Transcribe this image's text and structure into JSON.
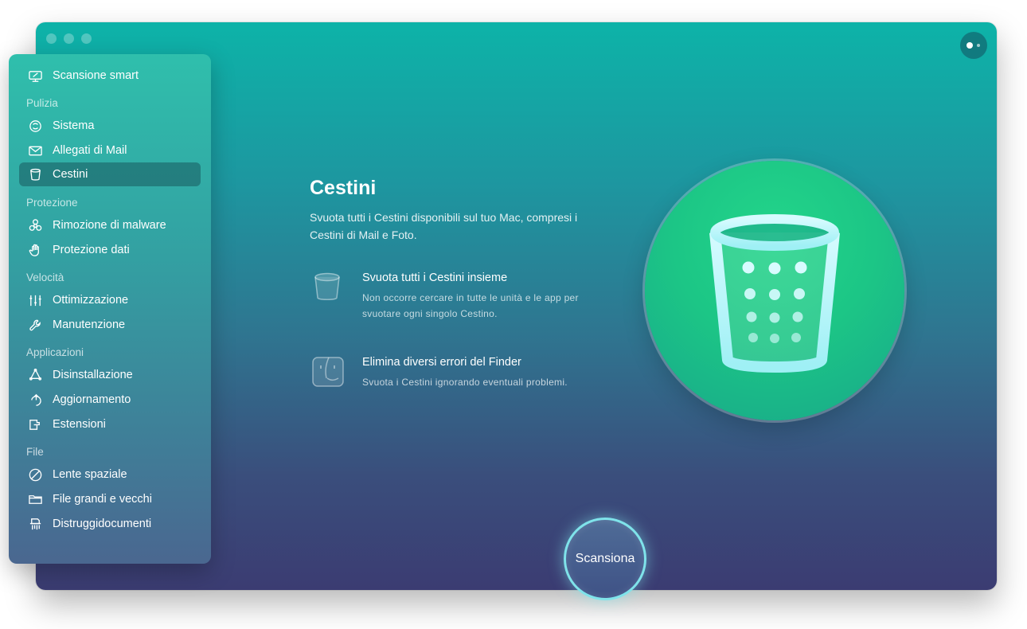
{
  "sidebar": {
    "top_item": {
      "label": "Scansione smart",
      "icon": "monitor-icon"
    },
    "sections": [
      {
        "title": "Pulizia",
        "items": [
          {
            "label": "Sistema",
            "icon": "system-icon"
          },
          {
            "label": "Allegati di Mail",
            "icon": "mail-icon"
          },
          {
            "label": "Cestini",
            "icon": "trash-icon",
            "active": true
          }
        ]
      },
      {
        "title": "Protezione",
        "items": [
          {
            "label": "Rimozione di malware",
            "icon": "biohazard-icon"
          },
          {
            "label": "Protezione dati",
            "icon": "hand-icon"
          }
        ]
      },
      {
        "title": "Velocità",
        "items": [
          {
            "label": "Ottimizzazione",
            "icon": "sliders-icon"
          },
          {
            "label": "Manutenzione",
            "icon": "wrench-icon"
          }
        ]
      },
      {
        "title": "Applicazioni",
        "items": [
          {
            "label": "Disinstallazione",
            "icon": "uninstall-icon"
          },
          {
            "label": "Aggiornamento",
            "icon": "update-icon"
          },
          {
            "label": "Estensioni",
            "icon": "extensions-icon"
          }
        ]
      },
      {
        "title": "File",
        "items": [
          {
            "label": "Lente spaziale",
            "icon": "lens-icon"
          },
          {
            "label": "File grandi e vecchi",
            "icon": "folder-icon"
          },
          {
            "label": "Distruggidocumenti",
            "icon": "shredder-icon"
          }
        ]
      }
    ]
  },
  "main": {
    "title": "Cestini",
    "description": "Svuota tutti i Cestini disponibili sul tuo Mac, compresi i Cestini di Mail e Foto.",
    "features": [
      {
        "title": "Svuota tutti i Cestini insieme",
        "subtitle": "Non occorre cercare in tutte le unità e le app per svuotare ogni singolo Cestino.",
        "icon": "trash-icon"
      },
      {
        "title": "Elimina diversi errori del Finder",
        "subtitle": "Svuota i Cestini ignorando eventuali problemi.",
        "icon": "finder-icon"
      }
    ],
    "scan_label": "Scansiona"
  },
  "colors": {
    "accent": "#7fe3ea",
    "circle": "#1cc686"
  }
}
